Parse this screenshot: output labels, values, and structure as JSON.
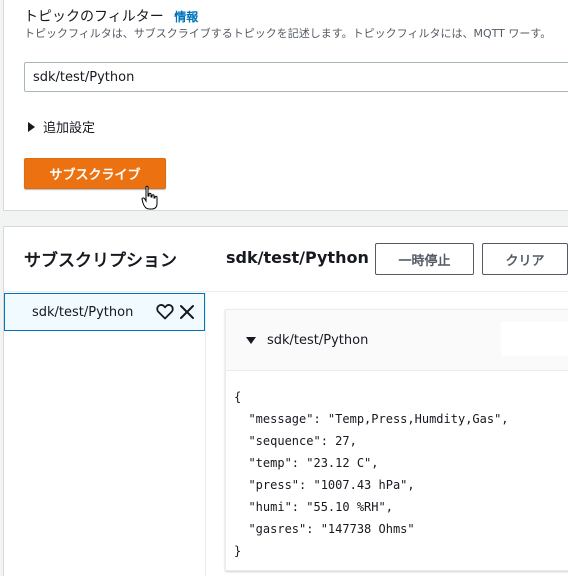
{
  "filter": {
    "label": "トピックのフィルター",
    "info_link": "情報",
    "description": "トピックフィルタは、サブスクライブするトピックを記述します。トピックフィルタには、MQTT ワーす。",
    "input_value": "sdk/test/Python",
    "additional_settings": "追加設定",
    "subscribe_button": "サブスクライブ"
  },
  "subscriptions": {
    "heading": "サブスクリプション",
    "items": [
      {
        "label": "sdk/test/Python"
      }
    ]
  },
  "detail": {
    "topic_title": "sdk/test/Python",
    "pause_button": "一時停止",
    "clear_button": "クリア",
    "message": {
      "topic": "sdk/test/Python",
      "payload": "{\n  \"message\": \"Temp,Press,Humdity,Gas\",\n  \"sequence\": 27,\n  \"temp\": \"23.12 C\",\n  \"press\": \"1007.43 hPa\",\n  \"humi\": \"55.10 %RH\",\n  \"gasres\": \"147738 Ohms\"\n}"
    }
  },
  "colors": {
    "accent": "#ec7211",
    "link": "#0073bb",
    "selected_bg": "#f1faff"
  },
  "icons": [
    "caret-right-icon",
    "pointer-cursor-icon",
    "heart-icon",
    "close-icon",
    "caret-down-icon"
  ]
}
